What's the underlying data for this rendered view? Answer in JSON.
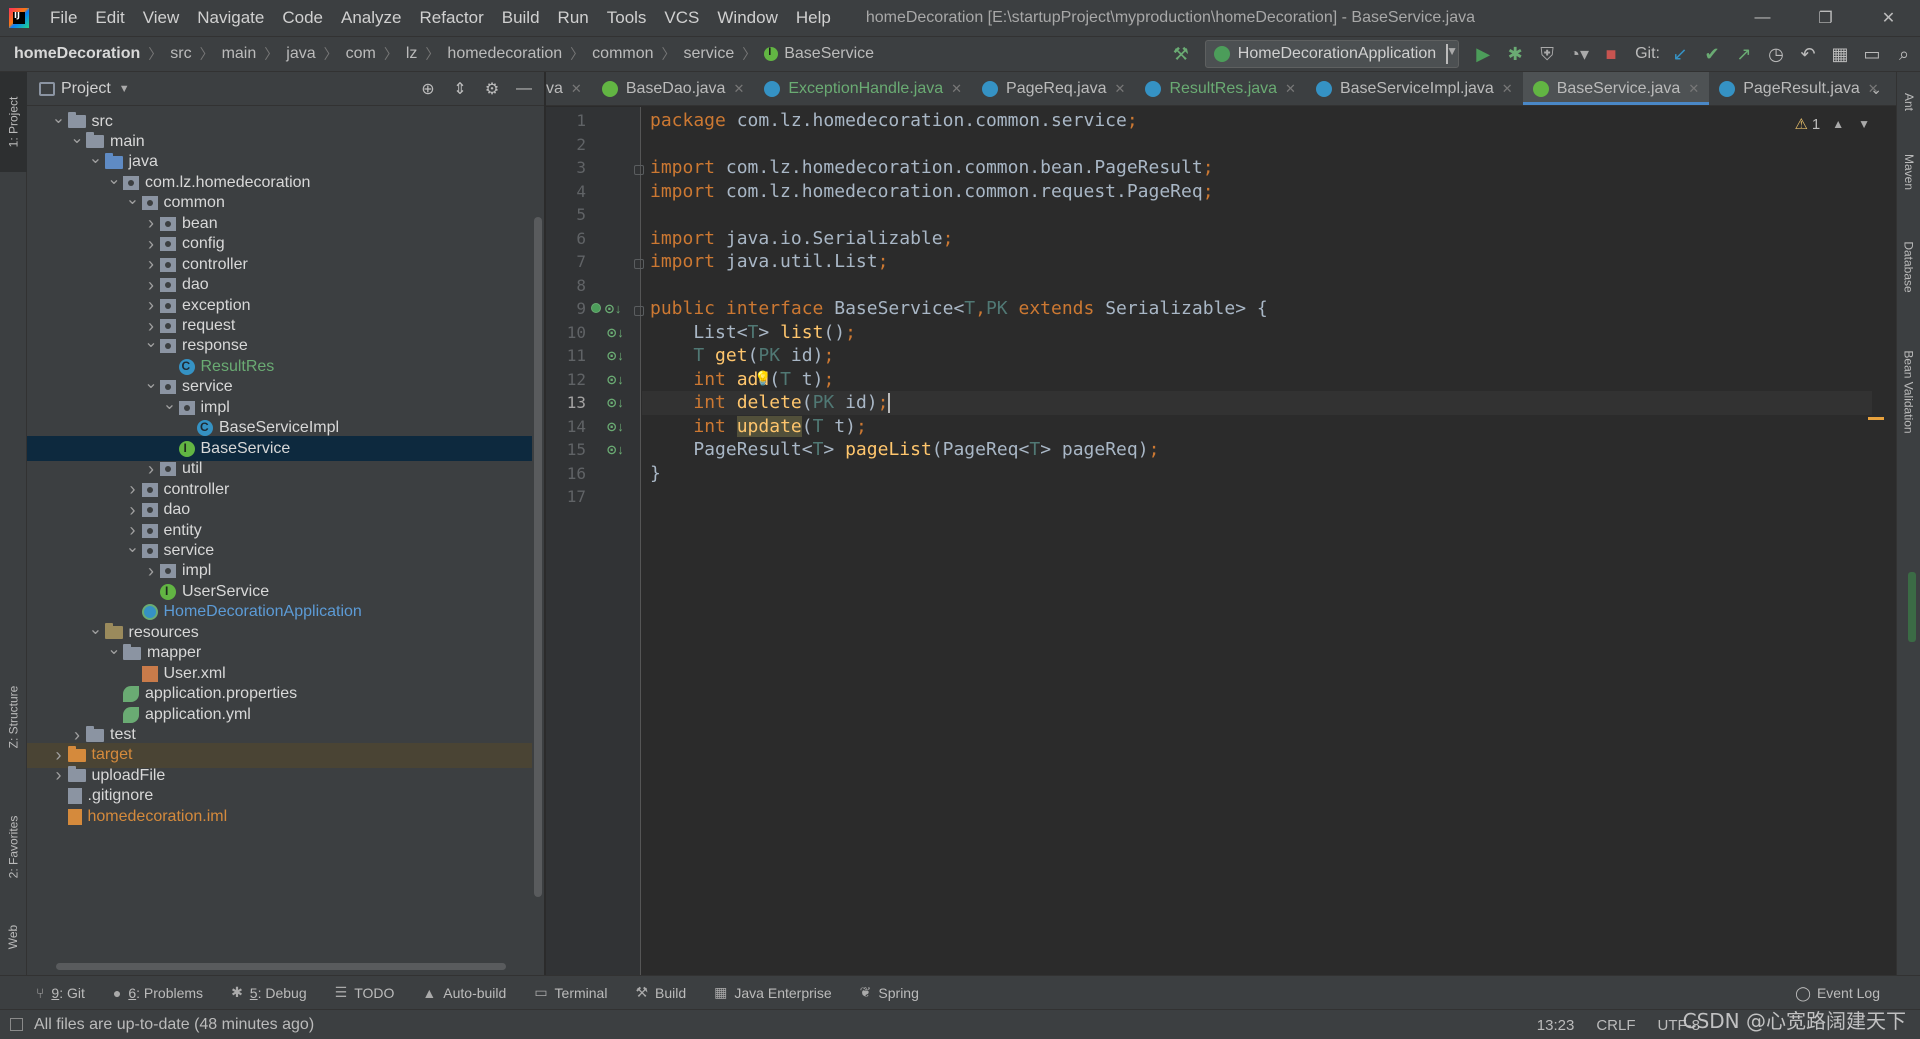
{
  "menubar": {
    "items": [
      "File",
      "Edit",
      "View",
      "Navigate",
      "Code",
      "Analyze",
      "Refactor",
      "Build",
      "Run",
      "Tools",
      "VCS",
      "Window",
      "Help"
    ],
    "window_title": "homeDecoration [E:\\startupProject\\myproduction\\homeDecoration] - BaseService.java"
  },
  "navbar": {
    "breadcrumbs": [
      "homeDecoration",
      "src",
      "main",
      "java",
      "com",
      "lz",
      "homedecoration",
      "common",
      "service",
      "BaseService"
    ],
    "run_config": "HomeDecorationApplication",
    "git_label": "Git:"
  },
  "left_stripe": {
    "project_tab": "1: Project",
    "structure_tab": "Z: Structure",
    "favorites_tab": "2: Favorites",
    "web_tab": "Web"
  },
  "project": {
    "title": "Project",
    "tree": [
      {
        "label": "src",
        "depth": 1,
        "expanded": true,
        "icon": "folder",
        "color": "white"
      },
      {
        "label": "main",
        "depth": 2,
        "expanded": true,
        "icon": "folder",
        "color": "white"
      },
      {
        "label": "java",
        "depth": 3,
        "expanded": true,
        "icon": "folder-src",
        "color": "white"
      },
      {
        "label": "com.lz.homedecoration",
        "depth": 4,
        "expanded": true,
        "icon": "package",
        "color": "white"
      },
      {
        "label": "common",
        "depth": 5,
        "expanded": true,
        "icon": "package",
        "color": "white"
      },
      {
        "label": "bean",
        "depth": 6,
        "expanded": false,
        "icon": "package",
        "color": "white"
      },
      {
        "label": "config",
        "depth": 6,
        "expanded": false,
        "icon": "package",
        "color": "white"
      },
      {
        "label": "controller",
        "depth": 6,
        "expanded": false,
        "icon": "package",
        "color": "white"
      },
      {
        "label": "dao",
        "depth": 6,
        "expanded": false,
        "icon": "package",
        "color": "white"
      },
      {
        "label": "exception",
        "depth": 6,
        "expanded": false,
        "icon": "package",
        "color": "white"
      },
      {
        "label": "request",
        "depth": 6,
        "expanded": false,
        "icon": "package",
        "color": "white"
      },
      {
        "label": "response",
        "depth": 6,
        "expanded": true,
        "icon": "package",
        "color": "white"
      },
      {
        "label": "ResultRes",
        "depth": 7,
        "expanded": null,
        "icon": "class",
        "color": "green"
      },
      {
        "label": "service",
        "depth": 6,
        "expanded": true,
        "icon": "package",
        "color": "white"
      },
      {
        "label": "impl",
        "depth": 7,
        "expanded": true,
        "icon": "package",
        "color": "white"
      },
      {
        "label": "BaseServiceImpl",
        "depth": 8,
        "expanded": null,
        "icon": "class",
        "color": "white"
      },
      {
        "label": "BaseService",
        "depth": 7,
        "expanded": null,
        "icon": "interface",
        "color": "white",
        "selected": true
      },
      {
        "label": "util",
        "depth": 6,
        "expanded": false,
        "icon": "package",
        "color": "white"
      },
      {
        "label": "controller",
        "depth": 5,
        "expanded": false,
        "icon": "package",
        "color": "white"
      },
      {
        "label": "dao",
        "depth": 5,
        "expanded": false,
        "icon": "package",
        "color": "white"
      },
      {
        "label": "entity",
        "depth": 5,
        "expanded": false,
        "icon": "package",
        "color": "white"
      },
      {
        "label": "service",
        "depth": 5,
        "expanded": true,
        "icon": "package",
        "color": "white"
      },
      {
        "label": "impl",
        "depth": 6,
        "expanded": false,
        "icon": "package",
        "color": "white"
      },
      {
        "label": "UserService",
        "depth": 6,
        "expanded": null,
        "icon": "interface",
        "color": "white"
      },
      {
        "label": "HomeDecorationApplication",
        "depth": 5,
        "expanded": null,
        "icon": "spring",
        "color": "blue"
      },
      {
        "label": "resources",
        "depth": 3,
        "expanded": true,
        "icon": "folder-res",
        "color": "white"
      },
      {
        "label": "mapper",
        "depth": 4,
        "expanded": true,
        "icon": "folder",
        "color": "white"
      },
      {
        "label": "User.xml",
        "depth": 5,
        "expanded": null,
        "icon": "xml",
        "color": "white"
      },
      {
        "label": "application.properties",
        "depth": 4,
        "expanded": null,
        "icon": "prop",
        "color": "white"
      },
      {
        "label": "application.yml",
        "depth": 4,
        "expanded": null,
        "icon": "prop",
        "color": "white"
      },
      {
        "label": "test",
        "depth": 2,
        "expanded": false,
        "icon": "folder",
        "color": "white"
      },
      {
        "label": "target",
        "depth": 1,
        "expanded": false,
        "icon": "folder-target",
        "color": "orange",
        "excluded": true
      },
      {
        "label": "uploadFile",
        "depth": 1,
        "expanded": false,
        "icon": "folder",
        "color": "white"
      },
      {
        "label": ".gitignore",
        "depth": 1,
        "expanded": null,
        "icon": "git",
        "color": "white"
      },
      {
        "label": "homedecoration.iml",
        "depth": 1,
        "expanded": null,
        "icon": "iml",
        "color": "orange"
      }
    ]
  },
  "editor_tabs": [
    {
      "label": "va",
      "icon": "none",
      "green": false,
      "active": false
    },
    {
      "label": "BaseDao.java",
      "icon": "interface",
      "green": false,
      "active": false
    },
    {
      "label": "ExceptionHandle.java",
      "icon": "class",
      "green": true,
      "active": false
    },
    {
      "label": "PageReq.java",
      "icon": "class",
      "green": false,
      "active": false
    },
    {
      "label": "ResultRes.java",
      "icon": "class",
      "green": true,
      "active": false
    },
    {
      "label": "BaseServiceImpl.java",
      "icon": "class",
      "green": false,
      "active": false
    },
    {
      "label": "BaseService.java",
      "icon": "interface",
      "green": false,
      "active": true
    },
    {
      "label": "PageResult.java",
      "icon": "class",
      "green": false,
      "active": false
    }
  ],
  "editor": {
    "current_line": 13,
    "warning_count": "1",
    "lines": [
      [
        {
          "t": "package ",
          "c": "kw"
        },
        {
          "t": "com.lz.homedecoration.common.service",
          "c": ""
        },
        {
          "t": ";",
          "c": "kw"
        }
      ],
      [],
      [
        {
          "t": "import ",
          "c": "kw"
        },
        {
          "t": "com.lz.homedecoration.common.bean.PageResult",
          "c": ""
        },
        {
          "t": ";",
          "c": "kw"
        }
      ],
      [
        {
          "t": "import ",
          "c": "kw"
        },
        {
          "t": "com.lz.homedecoration.common.request.PageReq",
          "c": ""
        },
        {
          "t": ";",
          "c": "kw"
        }
      ],
      [],
      [
        {
          "t": "import ",
          "c": "kw"
        },
        {
          "t": "java.io.Serializable",
          "c": ""
        },
        {
          "t": ";",
          "c": "kw"
        }
      ],
      [
        {
          "t": "import ",
          "c": "kw"
        },
        {
          "t": "java.util.List",
          "c": ""
        },
        {
          "t": ";",
          "c": "kw"
        }
      ],
      [],
      [
        {
          "t": "public interface ",
          "c": "kw"
        },
        {
          "t": "BaseService<",
          "c": ""
        },
        {
          "t": "T",
          "c": "tp"
        },
        {
          "t": ",",
          "c": "kw"
        },
        {
          "t": "PK ",
          "c": "tp"
        },
        {
          "t": "extends ",
          "c": "kw"
        },
        {
          "t": "Serializable> {",
          "c": ""
        }
      ],
      [
        {
          "t": "    List<",
          "c": ""
        },
        {
          "t": "T",
          "c": "tp"
        },
        {
          "t": "> ",
          "c": ""
        },
        {
          "t": "list",
          "c": "fn"
        },
        {
          "t": "()",
          "c": ""
        },
        {
          "t": ";",
          "c": "kw"
        }
      ],
      [
        {
          "t": "    ",
          "c": ""
        },
        {
          "t": "T ",
          "c": "tp"
        },
        {
          "t": "get",
          "c": "fn"
        },
        {
          "t": "(",
          "c": ""
        },
        {
          "t": "PK ",
          "c": "tp"
        },
        {
          "t": "id)",
          "c": ""
        },
        {
          "t": ";",
          "c": "kw"
        }
      ],
      [
        {
          "t": "    ",
          "c": ""
        },
        {
          "t": "int ",
          "c": "kw"
        },
        {
          "t": "add",
          "c": "fn"
        },
        {
          "t": "(",
          "c": ""
        },
        {
          "t": "T ",
          "c": "tp"
        },
        {
          "t": "t)",
          "c": ""
        },
        {
          "t": ";",
          "c": "kw"
        }
      ],
      [
        {
          "t": "    ",
          "c": ""
        },
        {
          "t": "int ",
          "c": "kw"
        },
        {
          "t": "delete",
          "c": "fn"
        },
        {
          "t": "(",
          "c": ""
        },
        {
          "t": "PK ",
          "c": "tp"
        },
        {
          "t": "id)",
          "c": ""
        },
        {
          "t": ";",
          "c": "kw"
        },
        {
          "t": "",
          "c": "caret"
        }
      ],
      [
        {
          "t": "    ",
          "c": ""
        },
        {
          "t": "int ",
          "c": "kw"
        },
        {
          "t": "update",
          "c": "fn hl"
        },
        {
          "t": "(",
          "c": ""
        },
        {
          "t": "T ",
          "c": "tp"
        },
        {
          "t": "t)",
          "c": ""
        },
        {
          "t": ";",
          "c": "kw"
        }
      ],
      [
        {
          "t": "    PageResult<",
          "c": ""
        },
        {
          "t": "T",
          "c": "tp"
        },
        {
          "t": "> ",
          "c": ""
        },
        {
          "t": "pageList",
          "c": "fn"
        },
        {
          "t": "(PageReq<",
          "c": ""
        },
        {
          "t": "T",
          "c": "tp"
        },
        {
          "t": "> pageReq)",
          "c": ""
        },
        {
          "t": ";",
          "c": "kw"
        }
      ],
      [
        {
          "t": "}",
          "c": ""
        }
      ],
      []
    ]
  },
  "right_stripe": {
    "ant_tab": "Ant",
    "maven_tab": "Maven",
    "database_tab": "Database",
    "bean_validation_tab": "Bean Validation"
  },
  "bottom_tools": [
    {
      "key": "9",
      "rest": ": Git",
      "icon": "⑂"
    },
    {
      "key": "6",
      "rest": ": Problems",
      "icon": "●"
    },
    {
      "key": "5",
      "rest": ": Debug",
      "icon": "✱"
    },
    {
      "key": "",
      "rest": "TODO",
      "icon": "☰"
    },
    {
      "key": "",
      "rest": "Auto-build",
      "icon": "▲"
    },
    {
      "key": "",
      "rest": "Terminal",
      "icon": "▭"
    },
    {
      "key": "",
      "rest": "Build",
      "icon": "⚒"
    },
    {
      "key": "",
      "rest": "Java Enterprise",
      "icon": "▦"
    },
    {
      "key": "",
      "rest": "Spring",
      "icon": "❦"
    }
  ],
  "event_log": "Event Log",
  "statusbar": {
    "message": "All files are up-to-date (48 minutes ago)",
    "position": "13:23",
    "line_separator": "CRLF",
    "encoding": "UTF-8",
    "watermark": "CSDN @心宽路阔建天下"
  }
}
